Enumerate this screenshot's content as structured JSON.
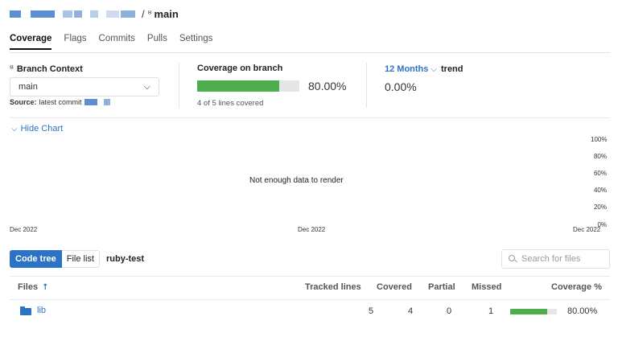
{
  "breadcrumb": {
    "branch": "main",
    "separator": "/",
    "redacted_blocks": [
      {
        "color": "#5b8fd4"
      },
      {
        "color": "#a9c3e8"
      },
      {
        "color": "#5b8fd4"
      },
      {
        "color": "#b7cde9"
      },
      {
        "color": "#d0dced"
      },
      {
        "color": "#8fb0dc"
      }
    ]
  },
  "tabs": [
    {
      "label": "Coverage",
      "active": true
    },
    {
      "label": "Flags",
      "active": false
    },
    {
      "label": "Commits",
      "active": false
    },
    {
      "label": "Pulls",
      "active": false
    },
    {
      "label": "Settings",
      "active": false
    }
  ],
  "branch_context": {
    "title": "Branch Context",
    "selected": "main",
    "source_label": "Source:",
    "source_text": "latest commit"
  },
  "coverage": {
    "title": "Coverage on branch",
    "percent_text": "80.00%",
    "fraction": 0.8,
    "lines_text": "4 of 5 lines covered"
  },
  "trend": {
    "period": "12 Months",
    "label": "trend",
    "value": "0.00%"
  },
  "chart": {
    "toggle_label": "Hide Chart",
    "empty_message": "Not enough data to render",
    "y_ticks": [
      "100%",
      "80%",
      "60%",
      "40%",
      "20%",
      "0%"
    ],
    "x_ticks": [
      "Dec 2022",
      "Dec 2022",
      "Dec 2022"
    ]
  },
  "toolbar": {
    "view_options": [
      "Code tree",
      "File list"
    ],
    "active_view": "Code tree",
    "flag": "ruby-test",
    "search_placeholder": "Search for files"
  },
  "table": {
    "headers": {
      "files": "Files",
      "tracked": "Tracked lines",
      "covered": "Covered",
      "partial": "Partial",
      "missed": "Missed",
      "coverage": "Coverage %"
    },
    "rows": [
      {
        "name": "lib",
        "tracked": "5",
        "covered": "4",
        "partial": "0",
        "missed": "1",
        "coverage_text": "80.00%",
        "coverage_fraction": 0.8
      }
    ]
  },
  "colors": {
    "accent": "#2d73c5",
    "success": "#4cae4c",
    "bar_track": "#e6e6e6"
  },
  "icons": [
    "branch-icon",
    "chevron-down-icon",
    "arrow-up-icon",
    "folder-icon",
    "search-icon"
  ]
}
